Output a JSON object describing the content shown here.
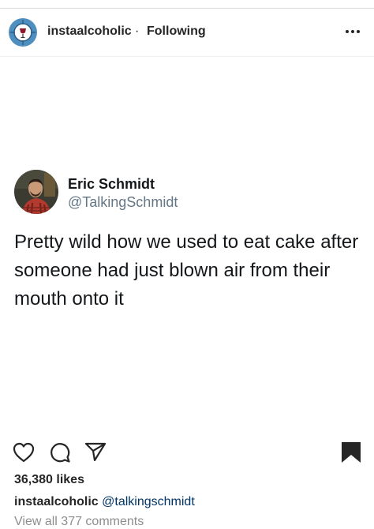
{
  "post_header": {
    "username": "instaalcoholic",
    "separator": "·",
    "follow_status": "Following",
    "avatar_icon": "wine-glass-target-icon",
    "more_icon": "more-options-icon"
  },
  "tweet": {
    "display_name": "Eric Schmidt",
    "handle": "@TalkingSchmidt",
    "text": "Pretty wild how we used to eat cake after someone had just blown air from their mouth onto it"
  },
  "actions": {
    "like_icon": "heart-icon",
    "comment_icon": "comment-icon",
    "share_icon": "paper-plane-icon",
    "save_icon": "bookmark-icon"
  },
  "likes_text": "36,380 likes",
  "caption": {
    "username": "instaalcoholic",
    "mention": "@talkingschmidt"
  },
  "view_comments_text": "View all 377 comments",
  "colors": {
    "text": "#262626",
    "tweet_text": "#14171a",
    "handle": "#657786",
    "mention": "#003569",
    "muted": "#8e8e8e",
    "avatar_ring": "#4f8fc0"
  }
}
